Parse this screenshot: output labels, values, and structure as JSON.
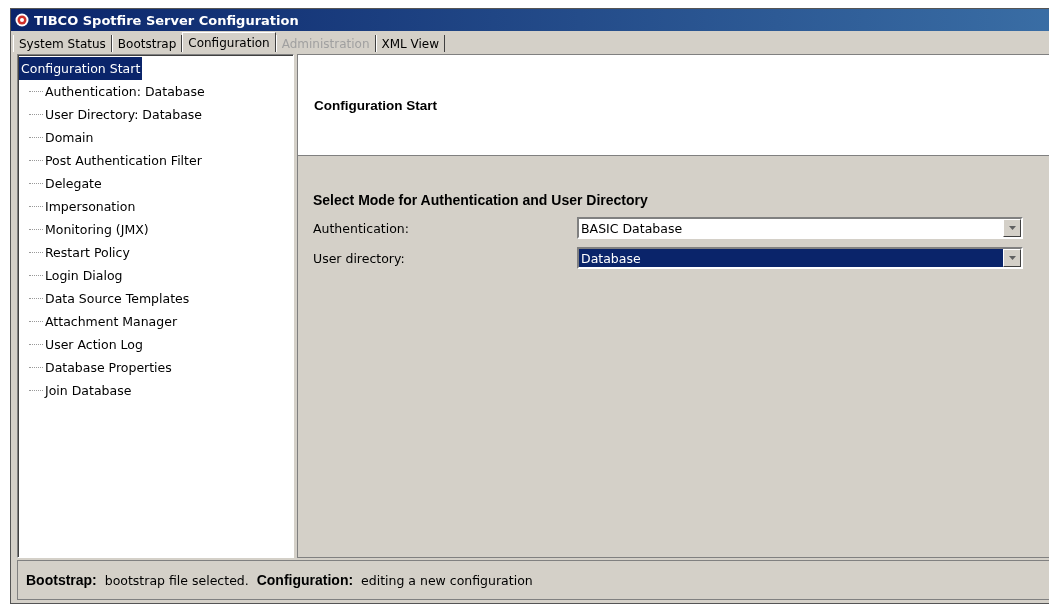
{
  "window": {
    "title": "TIBCO Spotfire Server Configuration"
  },
  "tabs": [
    {
      "label": "System Status",
      "selected": false,
      "disabled": false
    },
    {
      "label": "Bootstrap",
      "selected": false,
      "disabled": false
    },
    {
      "label": "Configuration",
      "selected": true,
      "disabled": false
    },
    {
      "label": "Administration",
      "selected": false,
      "disabled": true
    },
    {
      "label": "XML View",
      "selected": false,
      "disabled": false
    }
  ],
  "tree": {
    "label": "Configuration Start",
    "selected": true,
    "children": [
      {
        "label": "Authentication: Database",
        "selected": false
      },
      {
        "label": "User Directory: Database",
        "selected": false
      },
      {
        "label": "Domain",
        "selected": false
      },
      {
        "label": "Post Authentication Filter",
        "selected": false
      },
      {
        "label": "Delegate",
        "selected": false
      },
      {
        "label": "Impersonation",
        "selected": false
      },
      {
        "label": "Monitoring (JMX)",
        "selected": false
      },
      {
        "label": "Restart Policy",
        "selected": false
      },
      {
        "label": "Login Dialog",
        "selected": false
      },
      {
        "label": "Data Source Templates",
        "selected": false
      },
      {
        "label": "Attachment Manager",
        "selected": false
      },
      {
        "label": "User Action Log",
        "selected": false
      },
      {
        "label": "Database Properties",
        "selected": false
      },
      {
        "label": "Join Database",
        "selected": false
      }
    ]
  },
  "header": {
    "title": "Configuration Start"
  },
  "section": {
    "title": "Select Mode for Authentication and User Directory",
    "fields": [
      {
        "label": "Authentication:",
        "value": "BASIC Database",
        "focused": false
      },
      {
        "label": "User directory:",
        "value": "Database",
        "focused": true
      }
    ]
  },
  "status_bar": "**Bootstrap:**  bootstrap file selected.  **Configuration:**  editing a new configuration"
}
